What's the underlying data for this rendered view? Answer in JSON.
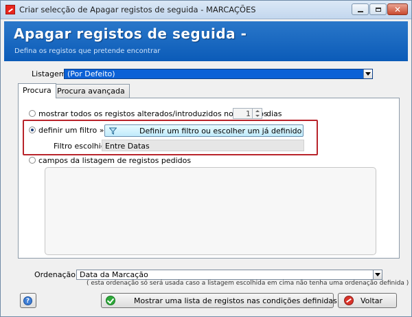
{
  "window": {
    "title": "Criar selecção de Apagar registos de seguida - MARCAÇÕES",
    "controls": {
      "minimize": "minimize",
      "maximize": "maximize",
      "close": "✕"
    }
  },
  "banner": {
    "title": "Apagar registos de seguida -",
    "subtitle": "Defina os registos que pretende encontrar"
  },
  "listagem": {
    "label": "Listagem :",
    "value": "(Por Defeito)"
  },
  "tabs": [
    {
      "label": "Procura",
      "active": true
    },
    {
      "label": "Procura avançada",
      "active": false
    }
  ],
  "options": {
    "all_changed": {
      "label": "mostrar todos os registos alterados/introduzidos nos últimos",
      "selected": false
    },
    "days_value": "1",
    "days_label": "dias",
    "filter": {
      "label": "definir um filtro »»»",
      "selected": true
    },
    "filter_button": "Definir um filtro ou escolher um já definido",
    "filtro_escolhido_label": "Filtro escolhido",
    "filtro_escolhido_value": "Entre Datas",
    "fields": {
      "label": "campos da listagem de registos pedidos",
      "selected": false
    }
  },
  "ordenacao": {
    "label": "Ordenação :",
    "value": "Data da Marcação",
    "note": "( esta ordenação só será usada caso a listagem escolhida em cima não tenha uma ordenação definida )"
  },
  "buttons": {
    "help": "?",
    "show_list": "Mostrar uma lista de registos nas condições definidas",
    "back": "Voltar"
  },
  "colors": {
    "banner": "#1565c0",
    "highlight_border": "#b8232a",
    "selected_combo": "#0b61d6"
  }
}
